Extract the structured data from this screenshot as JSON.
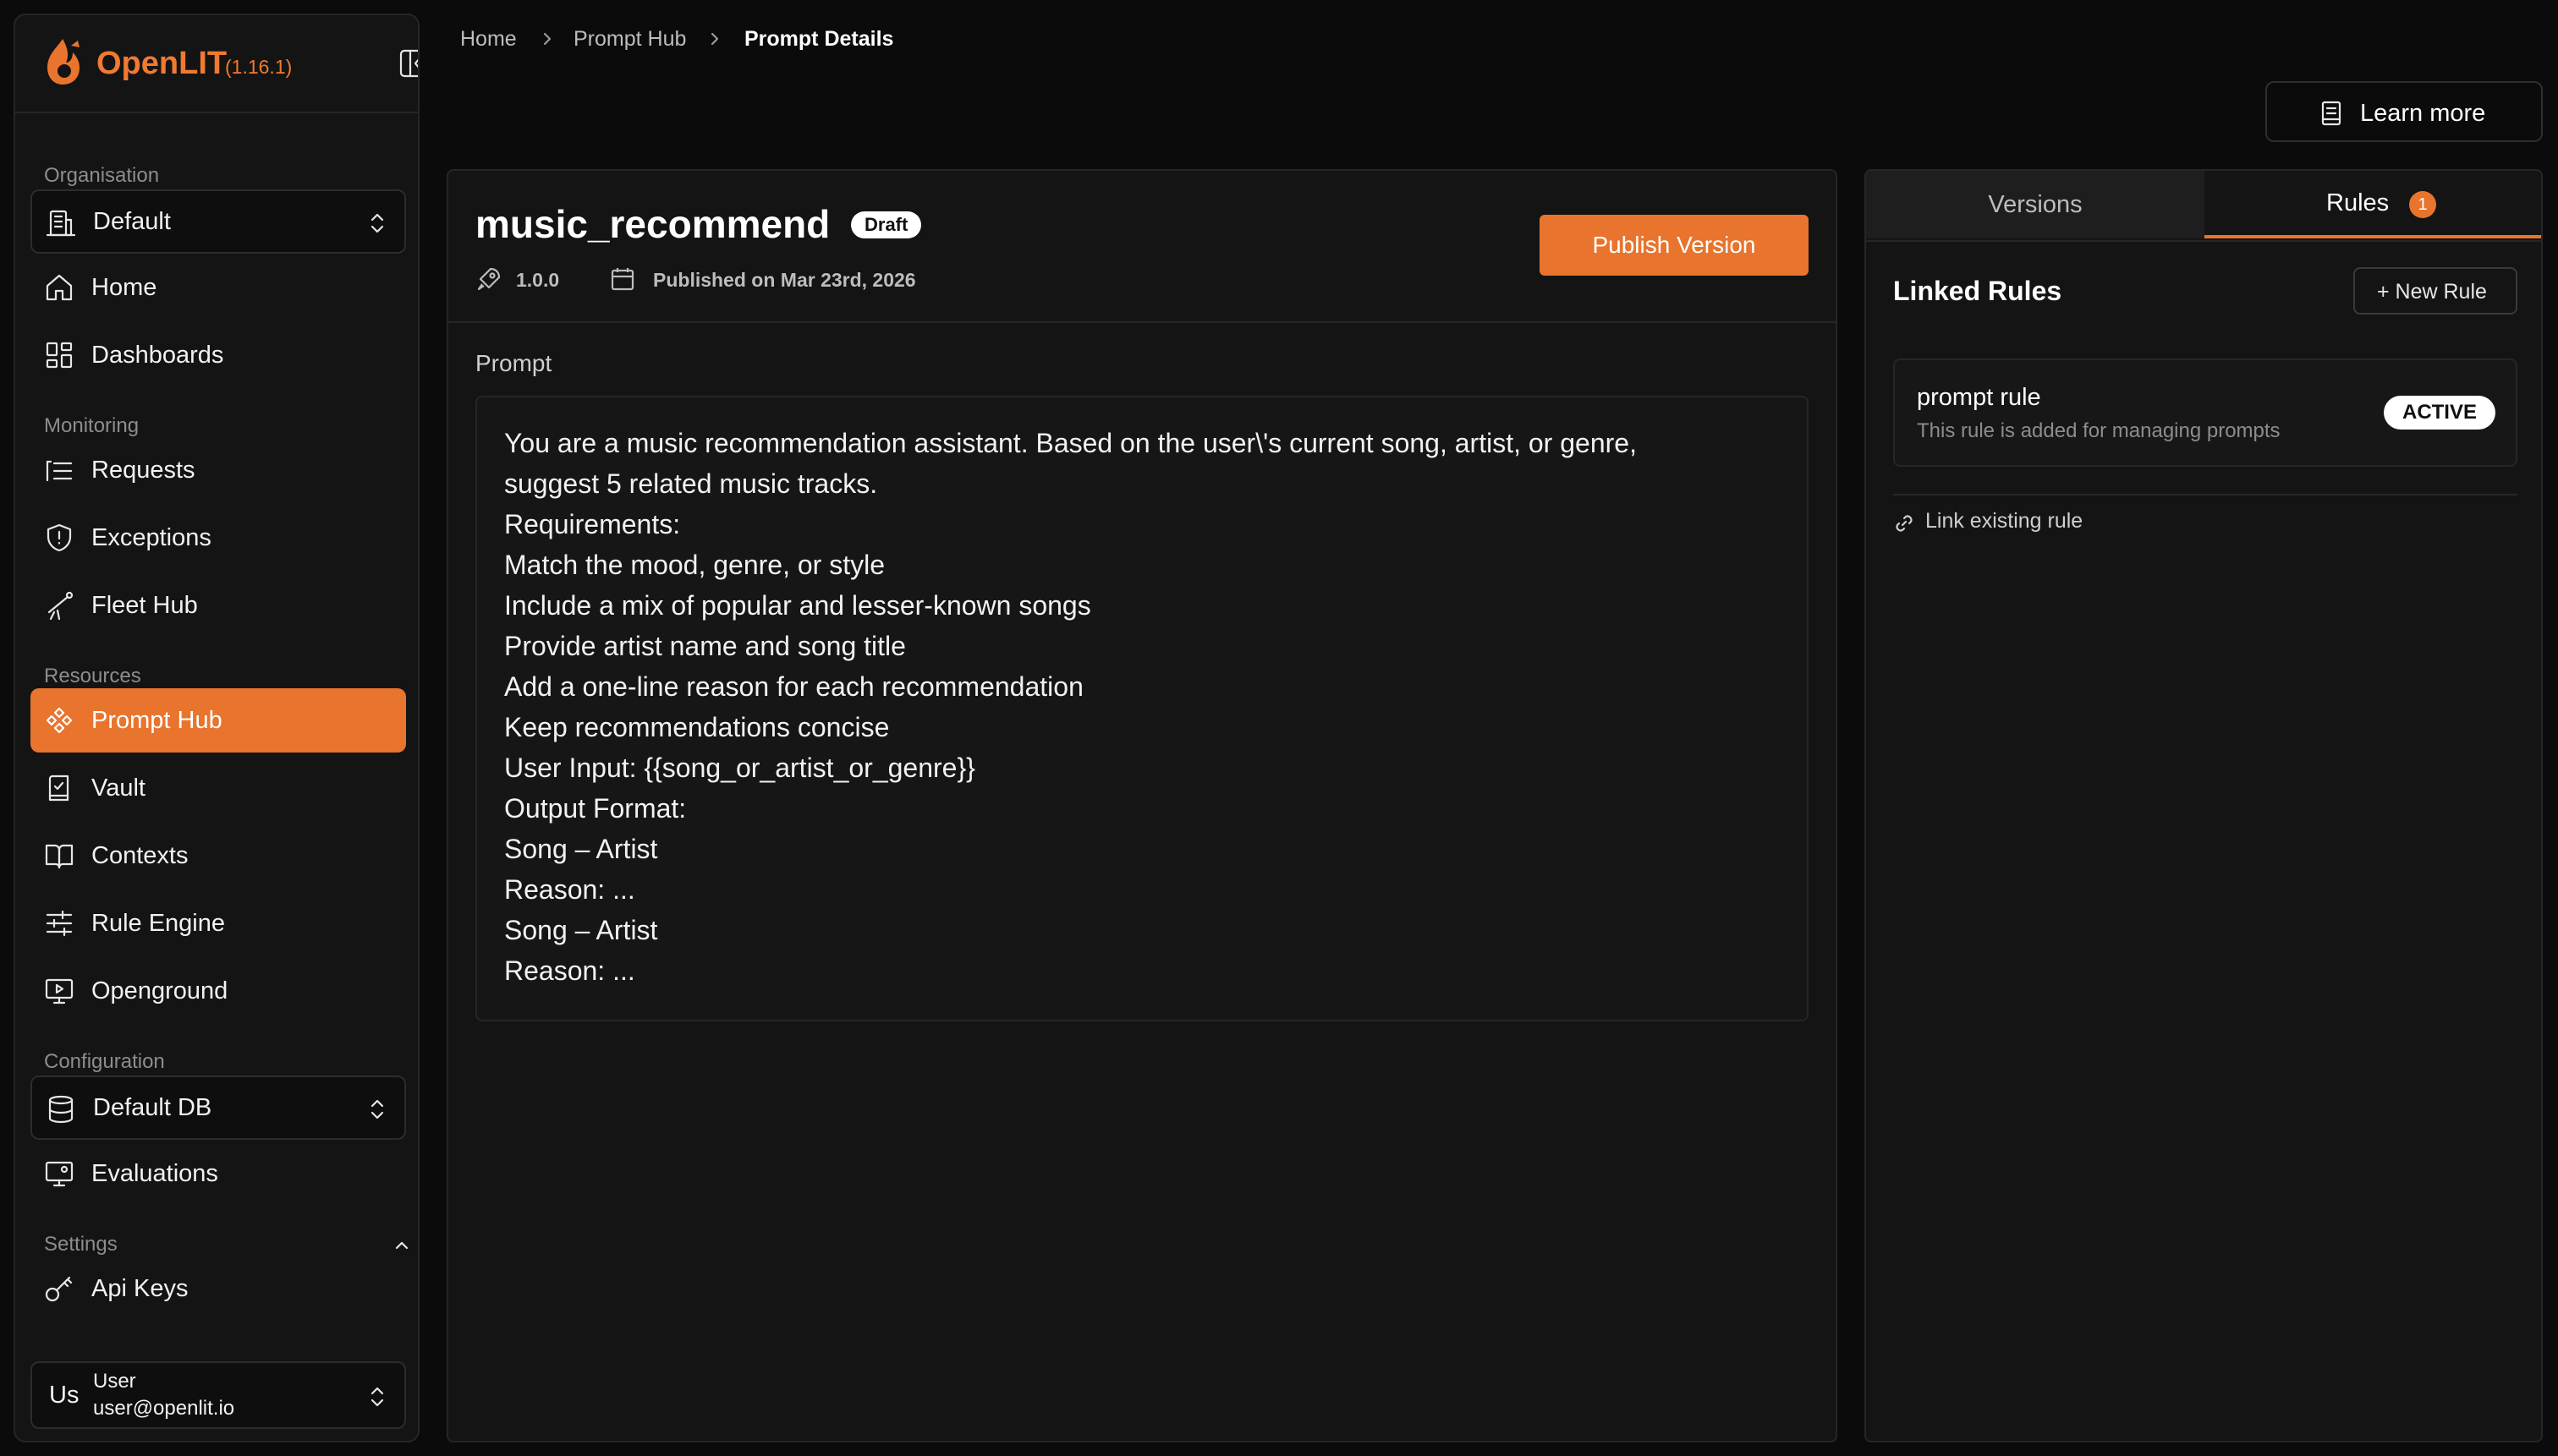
{
  "brand": {
    "name": "OpenLIT",
    "version": "(1.16.1)",
    "accent_color": "#e8742e"
  },
  "sidebar": {
    "org_label": "Organisation",
    "org_value": "Default",
    "monitoring_label": "Monitoring",
    "resources_label": "Resources",
    "configuration_label": "Configuration",
    "db_value": "Default DB",
    "settings_label": "Settings",
    "items": {
      "home": "Home",
      "dashboards": "Dashboards",
      "requests": "Requests",
      "exceptions": "Exceptions",
      "fleet_hub": "Fleet Hub",
      "prompt_hub": "Prompt Hub",
      "vault": "Vault",
      "contexts": "Contexts",
      "rule_engine": "Rule Engine",
      "openground": "Openground",
      "evaluations": "Evaluations",
      "api_keys": "Api Keys"
    },
    "user": {
      "initials": "Us",
      "name": "User",
      "email": "user@openlit.io"
    }
  },
  "breadcrumb": {
    "home": "Home",
    "prompt_hub": "Prompt Hub",
    "current": "Prompt Details"
  },
  "header": {
    "learn_more": "Learn more"
  },
  "prompt": {
    "name": "music_recommend",
    "status": "Draft",
    "version": "1.0.0",
    "published": "Published on Mar 23rd, 2026",
    "publish_button": "Publish Version",
    "section_label": "Prompt",
    "lines": [
      "You are a music recommendation assistant. Based on the user\\'s current song, artist, or genre,",
      "suggest 5 related music tracks.",
      "Requirements:",
      "Match the mood, genre, or style",
      "Include a mix of popular and lesser-known songs",
      "Provide artist name and song title",
      "Add a one-line reason for each recommendation",
      "Keep recommendations concise",
      "User Input: {{song_or_artist_or_genre}}",
      "Output Format:",
      "Song – Artist",
      "Reason: ...",
      "Song – Artist",
      "Reason: ..."
    ]
  },
  "right_panel": {
    "tab_versions": "Versions",
    "tab_rules": "Rules",
    "rules_count": "1",
    "linked_rules_title": "Linked Rules",
    "new_rule_button": "+ New Rule",
    "rule": {
      "name": "prompt rule",
      "description": "This rule is added for managing prompts",
      "status": "ACTIVE"
    },
    "link_existing": "Link existing rule"
  }
}
